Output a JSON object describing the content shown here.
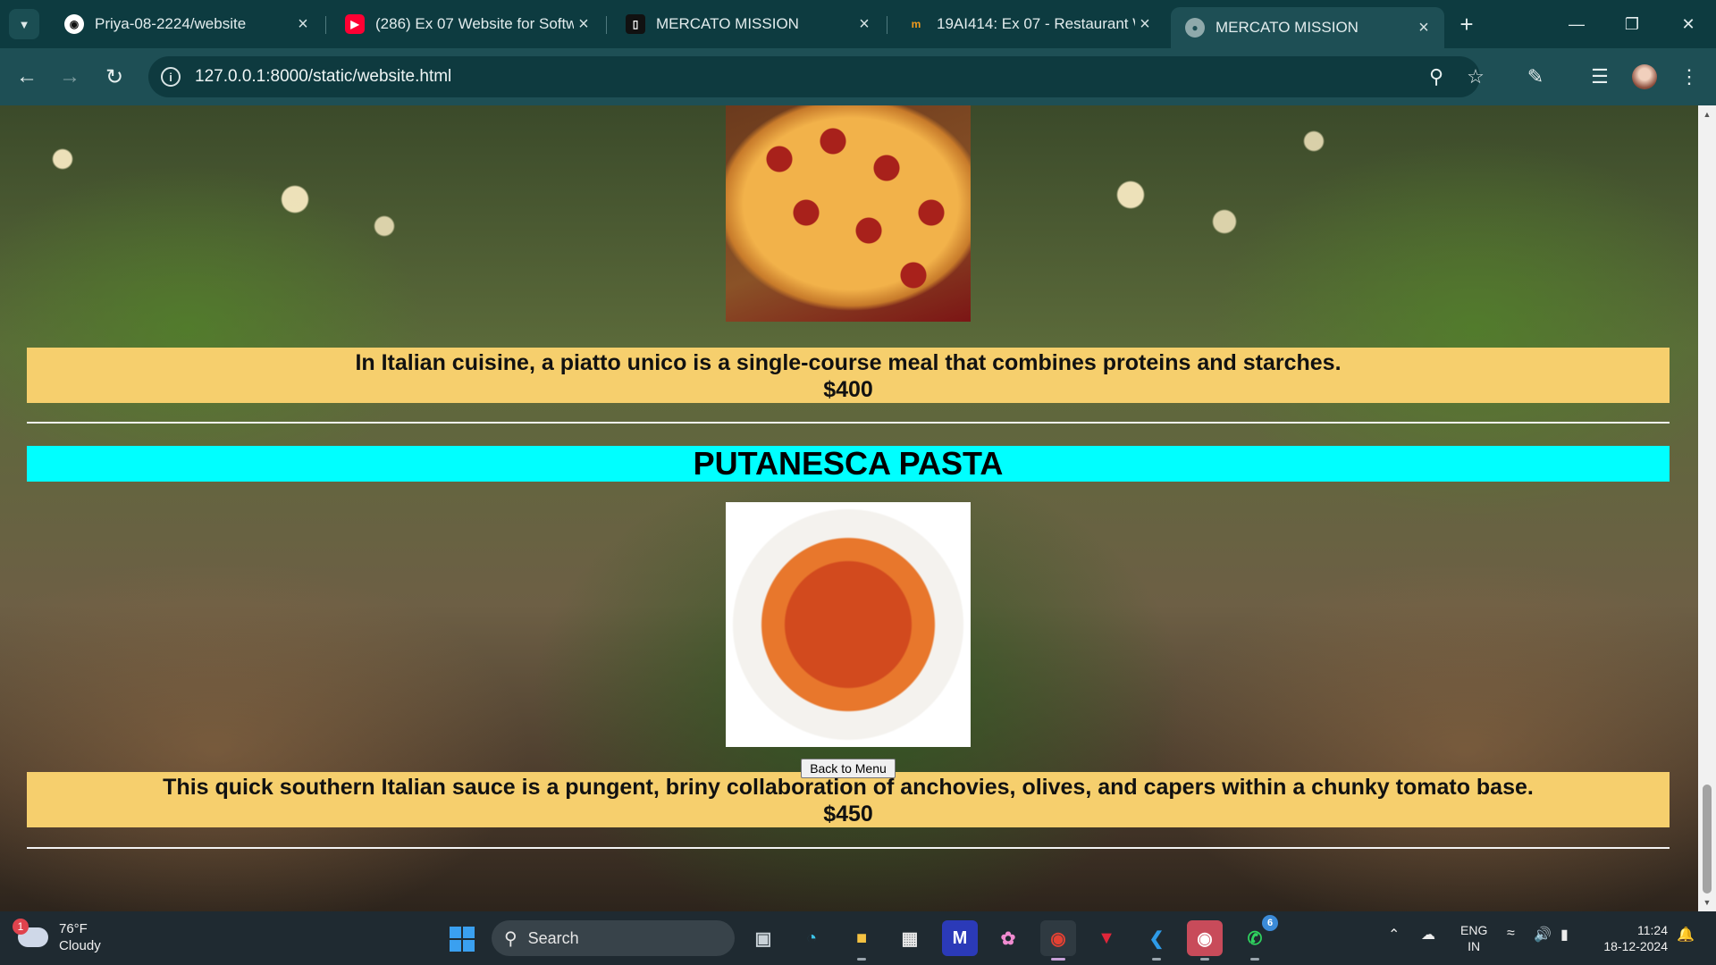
{
  "browser": {
    "tabs": [
      {
        "title": "Priya-08-2224/website",
        "icon": "github-icon"
      },
      {
        "title": "(286) Ex 07 Website for Softw",
        "icon": "youtube-icon"
      },
      {
        "title": "MERCATO MISSION",
        "icon": "mobile-icon"
      },
      {
        "title": "19AI414: Ex 07 - Restaurant W",
        "icon": "moodle-icon"
      },
      {
        "title": "MERCATO MISSION",
        "icon": "globe-icon",
        "active": true
      }
    ],
    "url": "127.0.0.1:8000/static/website.html"
  },
  "page": {
    "item1": {
      "description": "In Italian cuisine, a piatto unico is a single-course meal that combines proteins and starches.",
      "price": "$400"
    },
    "item2": {
      "name": "PUTANESCA PASTA",
      "description": "This quick southern Italian sauce is a pungent, briny collaboration of anchovies, olives, and capers within a chunky tomato base.",
      "price": "$450"
    },
    "back_button": "Back to Menu",
    "colors": {
      "description_bg": "#f6cf6d",
      "title_bg": "#00ffff"
    }
  },
  "taskbar": {
    "weather": {
      "temp": "76°F",
      "condition": "Cloudy",
      "badge": "1"
    },
    "search_placeholder": "Search",
    "whatsapp_badge": "6",
    "lang": {
      "line1": "ENG",
      "line2": "IN"
    },
    "clock": {
      "time": "11:24",
      "date": "18-12-2024"
    }
  }
}
